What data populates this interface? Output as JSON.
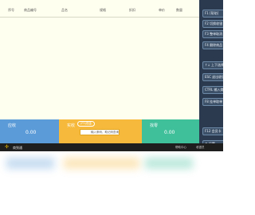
{
  "table": {
    "columns": [
      "序号",
      "商品编号",
      "品名",
      "规格",
      "折扣",
      "单价",
      "数量"
    ]
  },
  "function_keys": [
    {
      "key": "F1",
      "label": "F1 [帮助]"
    },
    {
      "key": "F2",
      "label": "F2 切换收银"
    },
    {
      "key": "F3",
      "label": "F3 整单取消"
    },
    {
      "key": "F4",
      "label": "F4 删除商品"
    },
    {
      "key": "arrows",
      "label": "↑↓ 上下选择"
    },
    {
      "key": "ESC",
      "label": "ESC 退出收银"
    },
    {
      "key": "CTRL",
      "label": "CTRL 输入商品"
    },
    {
      "key": "F8",
      "label": "F8 挂单取单"
    },
    {
      "key": "F12",
      "label": "F12 会员卡"
    },
    {
      "key": "settings",
      "label": "⚙ 设置"
    }
  ],
  "totals": {
    "total": {
      "label": "应收",
      "value": "0.00"
    },
    "received": {
      "label": "实收",
      "badge": "(F5)现金",
      "placeholder": "输入条码、助记码查询"
    },
    "change": {
      "label": "找零",
      "value": "0.00"
    }
  },
  "statusbar": {
    "brand": "商到通",
    "help": "帮助中心",
    "user": "收银员"
  },
  "colors": {
    "total_bg": "#5b9bd8",
    "received_bg": "#f6b93b",
    "change_bg": "#3fbf9a",
    "panel_bg": "#2b3a4e"
  }
}
